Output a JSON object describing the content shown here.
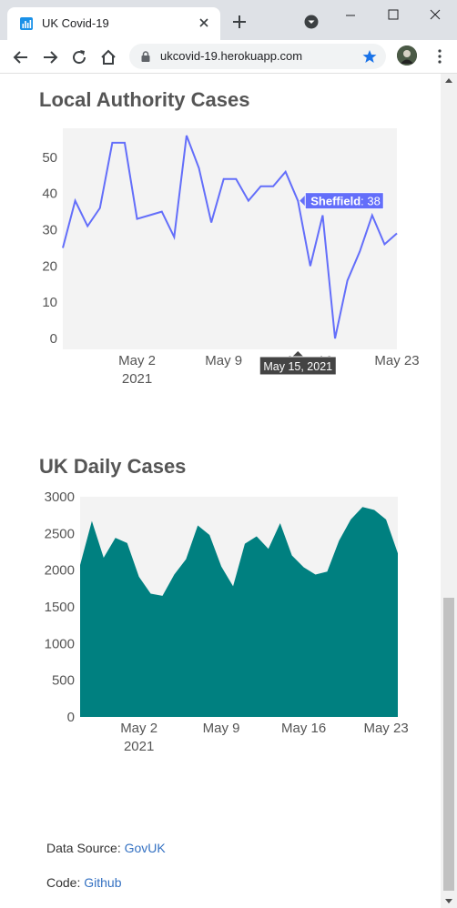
{
  "browser": {
    "tab_title": "UK Covid-19",
    "url": "ukcovid-19.herokuapp.com"
  },
  "local_section": {
    "heading": "Local Authority Cases"
  },
  "uk_section": {
    "heading": "UK Daily Cases"
  },
  "footer": {
    "data_source_label": "Data Source: ",
    "data_source_link": "GovUK",
    "code_label": "Code: ",
    "code_link": "Github"
  },
  "colors": {
    "line": "#636efa",
    "area": "#008080",
    "plot_bg": "#f3f3f3",
    "link": "#3471c2"
  },
  "chart_data": [
    {
      "type": "line",
      "series": [
        {
          "name": "Sheffield",
          "x": [
            "2021-04-26",
            "2021-04-27",
            "2021-04-28",
            "2021-04-29",
            "2021-04-30",
            "2021-05-01",
            "2021-05-02",
            "2021-05-03",
            "2021-05-04",
            "2021-05-05",
            "2021-05-06",
            "2021-05-07",
            "2021-05-08",
            "2021-05-09",
            "2021-05-10",
            "2021-05-11",
            "2021-05-12",
            "2021-05-13",
            "2021-05-14",
            "2021-05-15",
            "2021-05-16",
            "2021-05-17",
            "2021-05-18",
            "2021-05-19",
            "2021-05-20",
            "2021-05-21",
            "2021-05-22",
            "2021-05-23"
          ],
          "y": [
            25,
            38,
            31,
            36,
            54,
            54,
            33,
            34,
            35,
            28,
            56,
            47,
            32,
            44,
            44,
            38,
            42,
            42,
            46,
            38,
            20,
            34,
            0,
            16,
            24,
            34,
            26,
            29
          ]
        }
      ],
      "xticks": [
        {
          "value": "2021-05-02",
          "label": "May 2",
          "sublabel": "2021"
        },
        {
          "value": "2021-05-09",
          "label": "May 9"
        },
        {
          "value": "2021-05-16",
          "label": "May 16"
        },
        {
          "value": "2021-05-23",
          "label": "May 23"
        }
      ],
      "yticks": [
        0,
        10,
        20,
        30,
        40,
        50
      ],
      "ylim": [
        -3,
        58
      ],
      "grid": false,
      "hover": {
        "x_label": "May 15, 2021",
        "series": "Sheffield",
        "value": "38"
      }
    },
    {
      "type": "area",
      "series": [
        {
          "x": [
            "2021-04-27",
            "2021-04-28",
            "2021-04-29",
            "2021-04-30",
            "2021-05-01",
            "2021-05-02",
            "2021-05-03",
            "2021-05-04",
            "2021-05-05",
            "2021-05-06",
            "2021-05-07",
            "2021-05-08",
            "2021-05-09",
            "2021-05-10",
            "2021-05-11",
            "2021-05-12",
            "2021-05-13",
            "2021-05-14",
            "2021-05-15",
            "2021-05-16",
            "2021-05-17",
            "2021-05-18",
            "2021-05-19",
            "2021-05-20",
            "2021-05-21",
            "2021-05-22",
            "2021-05-23",
            "2021-05-24"
          ],
          "y": [
            2070,
            2670,
            2170,
            2440,
            2370,
            1910,
            1680,
            1650,
            1940,
            2150,
            2610,
            2480,
            2050,
            1780,
            2360,
            2460,
            2290,
            2640,
            2200,
            2040,
            1940,
            1980,
            2400,
            2690,
            2860,
            2820,
            2690,
            2230
          ]
        }
      ],
      "xticks": [
        {
          "value": "2021-05-02",
          "label": "May 2",
          "sublabel": "2021"
        },
        {
          "value": "2021-05-09",
          "label": "May 9"
        },
        {
          "value": "2021-05-16",
          "label": "May 16"
        },
        {
          "value": "2021-05-23",
          "label": "May 23"
        }
      ],
      "yticks": [
        0,
        500,
        1000,
        1500,
        2000,
        2500,
        3000
      ],
      "ylim": [
        0,
        3000
      ],
      "grid": false
    }
  ]
}
